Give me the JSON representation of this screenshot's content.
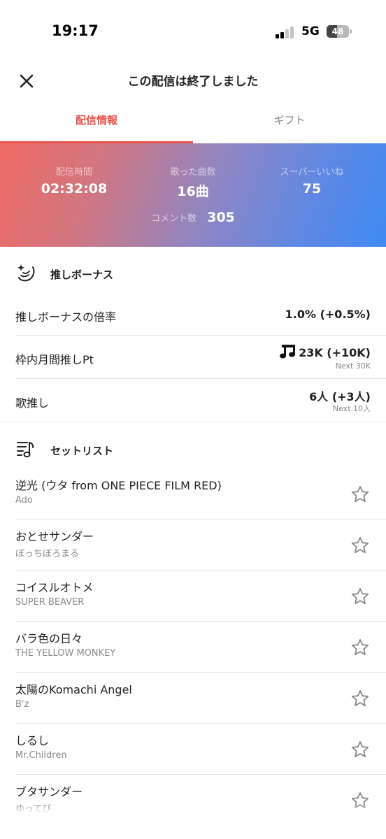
{
  "status_bar": {
    "time": "19:17",
    "network": "5G",
    "battery": "48",
    "battery_level": 0.48
  },
  "header": {
    "title": "この配信は終了しました"
  },
  "tabs": [
    {
      "label": "配信情報",
      "active": true
    },
    {
      "label": "ギフト",
      "active": false
    }
  ],
  "stats": {
    "duration_label": "配信時間",
    "duration": "02:32:08",
    "songs_label": "歌った曲数",
    "songs": "16曲",
    "superlike_label": "スーパーいいね",
    "superlike": "75",
    "comments_label": "コメント数",
    "comments": "305"
  },
  "bonus": {
    "title": "推しボーナス",
    "rows": [
      {
        "label": "推しボーナスの倍率",
        "value": "1.0% (+0.5%)"
      },
      {
        "label": "枠内月間推しPt",
        "value": "23K (+10K)",
        "sub": "Next 30K"
      },
      {
        "label": "歌推し",
        "value": "6人 (+3人)",
        "sub": "Next 10人"
      }
    ]
  },
  "setlist": {
    "title": "セットリスト",
    "songs": [
      {
        "title": "逆光 (ウタ from ONE PIECE FILM RED)",
        "artist": "Ado"
      },
      {
        "title": "おとせサンダー",
        "artist": "ぼっちぼろまる"
      },
      {
        "title": "コイスルオトメ",
        "artist": "SUPER BEAVER"
      },
      {
        "title": "バラ色の日々",
        "artist": "THE YELLOW MONKEY"
      },
      {
        "title": "太陽のKomachi Angel",
        "artist": "B'z"
      },
      {
        "title": "しるし",
        "artist": "Mr.Children"
      },
      {
        "title": "ブタサンダー",
        "artist": "ゆってび"
      }
    ]
  },
  "colors": {
    "accent": "#e8524a",
    "gradient_start": "#ef6a64",
    "gradient_end": "#3f8af2"
  }
}
